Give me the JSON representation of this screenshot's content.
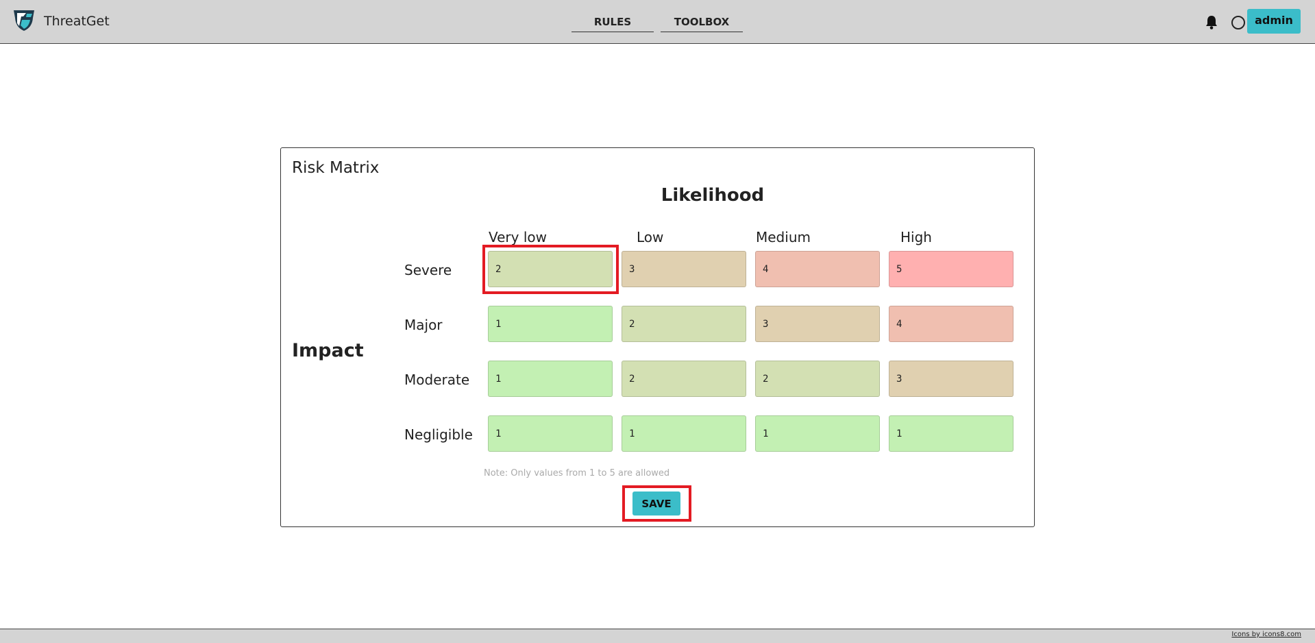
{
  "app": {
    "name": "ThreatGet",
    "logo_icon": "threatget-shield-logo"
  },
  "nav": {
    "tabs": [
      {
        "label": "RULES"
      },
      {
        "label": "TOOLBOX"
      }
    ]
  },
  "header": {
    "user_label": "admin",
    "bell_icon": "bell-icon",
    "status_icon": "circle-icon"
  },
  "risk_matrix": {
    "title": "Risk Matrix",
    "likelihood_label": "Likelihood",
    "impact_label": "Impact",
    "columns": [
      "Very low",
      "Low",
      "Medium",
      "High"
    ],
    "rows": [
      {
        "label": "Severe",
        "values": [
          "2",
          "3",
          "4",
          "5"
        ]
      },
      {
        "label": "Major",
        "values": [
          "1",
          "2",
          "3",
          "4"
        ]
      },
      {
        "label": "Moderate",
        "values": [
          "1",
          "2",
          "2",
          "3"
        ]
      },
      {
        "label": "Negligible",
        "values": [
          "1",
          "1",
          "1",
          "1"
        ]
      }
    ],
    "note": "Note: Only values from 1 to 5 are allowed",
    "save_label": "SAVE"
  },
  "level_colors": {
    "1": "#c3f0b3",
    "2": "#d3e0b3",
    "3": "#e0d0b0",
    "4": "#f0bfb0",
    "5": "#ffb0b0"
  },
  "highlight_color": "#e31b23",
  "accent_color": "#3bbdc9",
  "footer": {
    "credit": "Icons by icons8.com"
  }
}
